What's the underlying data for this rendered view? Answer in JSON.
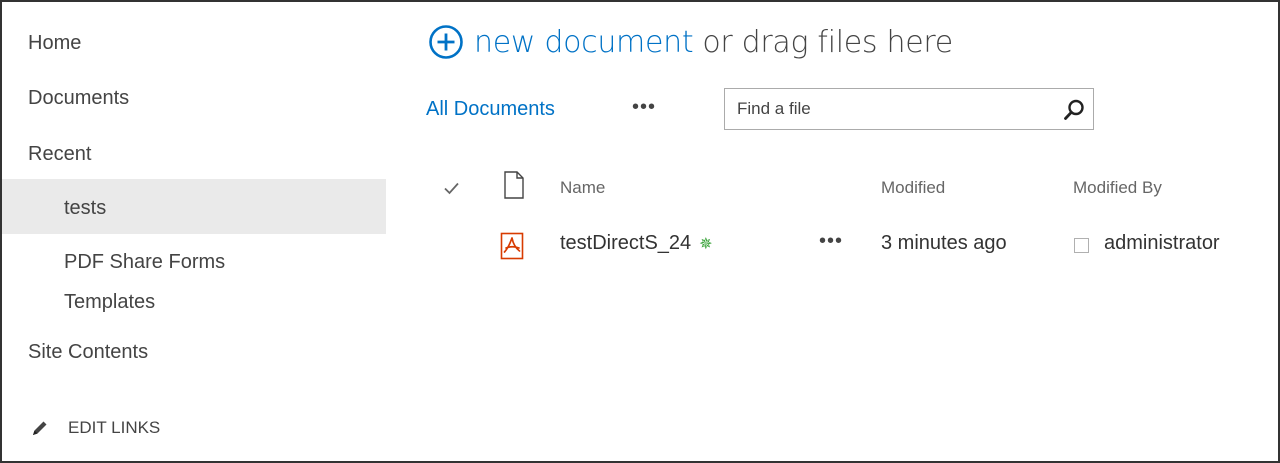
{
  "nav": {
    "items": [
      {
        "label": "Home"
      },
      {
        "label": "Documents"
      },
      {
        "label": "Recent"
      },
      {
        "label": "tests"
      },
      {
        "label_line1": "PDF Share Forms",
        "label_line2": "Templates"
      },
      {
        "label": "Site Contents"
      }
    ],
    "edit_links_label": "EDIT LINKS"
  },
  "toolbar": {
    "new_document_label": "new document",
    "drag_text": "or drag files here",
    "view_label": "All Documents",
    "more_label": "•••",
    "search_placeholder": "Find a file"
  },
  "list": {
    "columns": {
      "name": "Name",
      "modified": "Modified",
      "modified_by": "Modified By"
    },
    "rows": [
      {
        "name": "testDirectS_24",
        "new_badge": "✵",
        "more": "•••",
        "modified": "3 minutes ago",
        "modified_by": "administrator",
        "file_icon": "pdf-icon"
      }
    ]
  },
  "colors": {
    "accent": "#0072c6",
    "selected_bg": "#eaeaea",
    "new_badge": "#39a339",
    "pdf": "#d83b01"
  }
}
